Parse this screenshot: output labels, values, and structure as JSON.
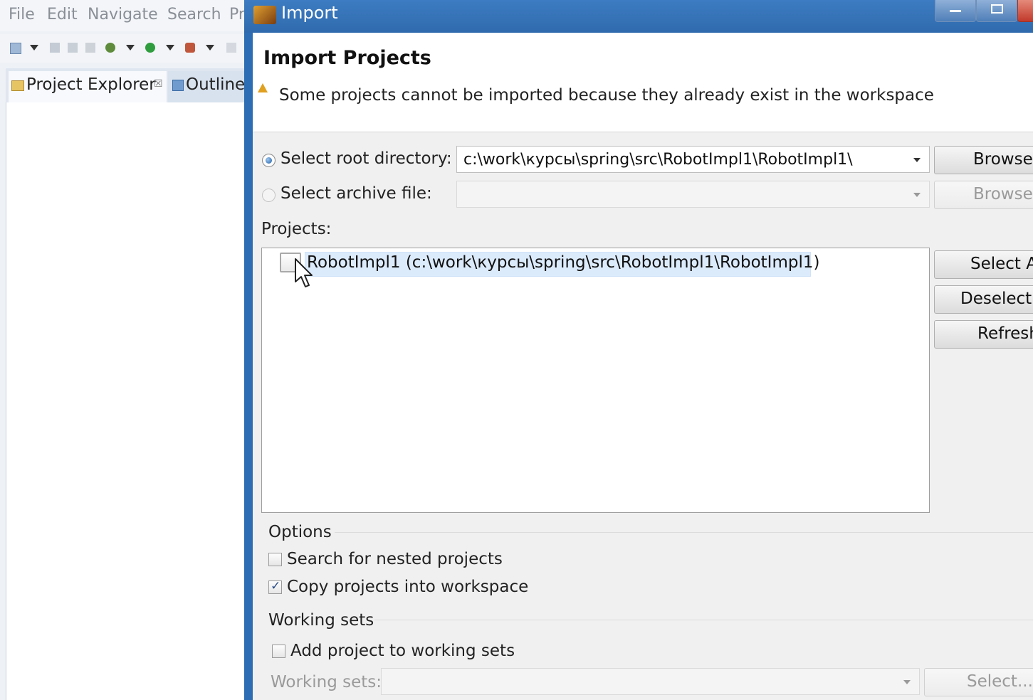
{
  "eclipse": {
    "menu": [
      "File",
      "Edit",
      "Navigate",
      "Search",
      "Pr"
    ],
    "tabs": {
      "project_explorer": "Project Explorer",
      "outline": "Outline",
      "close_glyph": "☒"
    }
  },
  "dialog": {
    "title": "Import",
    "header": {
      "title": "Import Projects",
      "warning": "Some projects cannot be imported because they already exist in the workspace"
    },
    "root_dir": {
      "label": "Select root directory:",
      "value": "c:\\work\\курсы\\spring\\src\\RobotImpl1\\RobotImpl1\\",
      "selected": true,
      "browse": "Browse..."
    },
    "archive": {
      "label": "Select archive file:",
      "value": "",
      "selected": false,
      "browse": "Browse..."
    },
    "projects": {
      "label": "Projects:",
      "items": [
        {
          "name": "RobotImpl1 (c:\\work\\курсы\\spring\\src\\RobotImpl1\\RobotImpl1)",
          "checked": false
        }
      ]
    },
    "side_buttons": {
      "select_all": "Select All",
      "deselect_all": "Deselect All",
      "refresh": "Refresh"
    },
    "options": {
      "title": "Options",
      "search_nested": {
        "label": "Search for nested projects",
        "checked": false
      },
      "copy_projects": {
        "label": "Copy projects into workspace",
        "checked": true
      }
    },
    "working_sets": {
      "title": "Working sets",
      "add_to_sets": {
        "label": "Add project to working sets",
        "checked": false
      },
      "field_label": "Working sets:",
      "select_button": "Select..."
    }
  },
  "colors": {
    "dialog_frame": "#2d6db3",
    "selection": "#dcebfc",
    "warning": "#e0a020"
  }
}
